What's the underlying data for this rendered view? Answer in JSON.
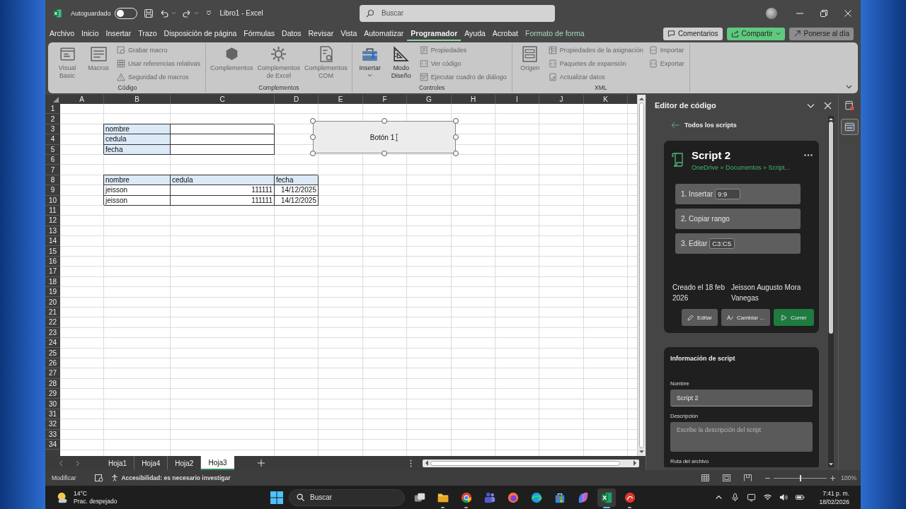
{
  "window": {
    "title": "Libro1 - Excel",
    "autosave": {
      "label": "Autoguardado",
      "on": false
    },
    "search": {
      "placeholder": "Buscar"
    }
  },
  "menu_tabs": [
    {
      "label": "Archivo",
      "kind": "standard",
      "selected": false
    },
    {
      "label": "Inicio",
      "kind": "standard",
      "selected": false
    },
    {
      "label": "Insertar",
      "kind": "standard",
      "selected": false
    },
    {
      "label": "Trazo",
      "kind": "standard",
      "selected": false
    },
    {
      "label": "Disposición de página",
      "kind": "standard",
      "selected": false
    },
    {
      "label": "Fórmulas",
      "kind": "standard",
      "selected": false
    },
    {
      "label": "Datos",
      "kind": "standard",
      "selected": false
    },
    {
      "label": "Revisar",
      "kind": "standard",
      "selected": false
    },
    {
      "label": "Vista",
      "kind": "standard",
      "selected": false
    },
    {
      "label": "Automatizar",
      "kind": "standard",
      "selected": false
    },
    {
      "label": "Programador",
      "kind": "standard",
      "selected": true
    },
    {
      "label": "Ayuda",
      "kind": "standard",
      "selected": false
    },
    {
      "label": "Acrobat",
      "kind": "standard",
      "selected": false
    },
    {
      "label": "Formato de forma",
      "kind": "contextual",
      "selected": false
    }
  ],
  "header_buttons": [
    {
      "label": "Comentarios",
      "kind": "comment"
    },
    {
      "label": "Compartir",
      "kind": "share"
    },
    {
      "label": "Ponerse al día",
      "kind": "catchup"
    }
  ],
  "ribbon": {
    "groups": [
      {
        "label": "Código",
        "columns": [
          {
            "kind": "large",
            "label": "Visual Basic",
            "disabled": true,
            "dropdown": false
          },
          {
            "kind": "large",
            "label": "Macros",
            "disabled": true,
            "dropdown": false
          },
          {
            "kind": "stack",
            "items": [
              {
                "label": "Grabar macro",
                "disabled": true
              },
              {
                "label": "Usar referencias relativas",
                "disabled": true
              },
              {
                "label": "Seguridad de macros",
                "disabled": true
              }
            ]
          }
        ]
      },
      {
        "label": "Complementos",
        "columns": [
          {
            "kind": "large",
            "label": "Complementos",
            "disabled": true,
            "dropdown": false
          },
          {
            "kind": "large",
            "label": "Complementos de Excel",
            "disabled": true,
            "dropdown": false
          },
          {
            "kind": "large",
            "label": "Complementos COM",
            "disabled": true,
            "dropdown": false
          }
        ]
      },
      {
        "label": "Controles",
        "columns": [
          {
            "kind": "large",
            "label": "Insertar",
            "disabled": false,
            "dropdown": true
          },
          {
            "kind": "large",
            "label": "Modo Diseño",
            "disabled": false,
            "dropdown": false
          },
          {
            "kind": "stack",
            "items": [
              {
                "label": "Propiedades",
                "disabled": true
              },
              {
                "label": "Ver código",
                "disabled": true
              },
              {
                "label": "Ejecutar cuadro de diálogo",
                "disabled": true
              }
            ]
          }
        ]
      },
      {
        "label": "XML",
        "columns": [
          {
            "kind": "large",
            "label": "Origen",
            "disabled": true,
            "dropdown": false
          },
          {
            "kind": "stack",
            "items": [
              {
                "label": "Propiedades de la asignación",
                "disabled": true
              },
              {
                "label": "Paquetes de expansión",
                "disabled": true
              },
              {
                "label": "Actualizar datos",
                "disabled": true
              }
            ]
          },
          {
            "kind": "stack",
            "items": [
              {
                "label": "Importar",
                "disabled": true
              },
              {
                "label": "Exportar",
                "disabled": true
              }
            ]
          }
        ]
      }
    ]
  },
  "sheet": {
    "columns": [
      "A",
      "B",
      "C",
      "D",
      "E",
      "F",
      "G",
      "H",
      "I",
      "J",
      "K"
    ],
    "rows": [
      {
        "number": "1"
      },
      {
        "number": "2"
      },
      {
        "number": "3",
        "cells": [
          {
            "kind": "empty"
          },
          {
            "kind": "header",
            "text": "nombre"
          },
          {
            "kind": "input"
          }
        ]
      },
      {
        "number": "4",
        "cells": [
          {
            "kind": "empty"
          },
          {
            "kind": "header",
            "text": "cedula"
          },
          {
            "kind": "input"
          }
        ]
      },
      {
        "number": "5",
        "cells": [
          {
            "kind": "empty"
          },
          {
            "kind": "header",
            "text": "fecha"
          },
          {
            "kind": "input"
          }
        ]
      },
      {
        "number": "6"
      },
      {
        "number": "7"
      },
      {
        "number": "8",
        "cells": [
          {
            "kind": "empty"
          },
          {
            "kind": "header",
            "text": "nombre"
          },
          {
            "kind": "header",
            "text": "cedula"
          },
          {
            "kind": "header",
            "text": "fecha"
          }
        ]
      },
      {
        "number": "9",
        "cells": [
          {
            "kind": "empty"
          },
          {
            "kind": "text",
            "text": "jeisson"
          },
          {
            "kind": "number",
            "text": "111111"
          },
          {
            "kind": "number",
            "text": "14/12/2025"
          }
        ]
      },
      {
        "number": "10",
        "cells": [
          {
            "kind": "empty"
          },
          {
            "kind": "text",
            "text": "jeisson"
          },
          {
            "kind": "number",
            "text": "111111"
          },
          {
            "kind": "number",
            "text": "14/12/2025"
          }
        ]
      },
      {
        "number": "11"
      },
      {
        "number": "12"
      },
      {
        "number": "13"
      },
      {
        "number": "14"
      },
      {
        "number": "15"
      },
      {
        "number": "16"
      },
      {
        "number": "17"
      },
      {
        "number": "18"
      },
      {
        "number": "19"
      },
      {
        "number": "20"
      },
      {
        "number": "21"
      },
      {
        "number": "22"
      },
      {
        "number": "23"
      },
      {
        "number": "24"
      },
      {
        "number": "25"
      },
      {
        "number": "26"
      },
      {
        "number": "27"
      },
      {
        "number": "28"
      },
      {
        "number": "29"
      },
      {
        "number": "30"
      },
      {
        "number": "31"
      },
      {
        "number": "32"
      },
      {
        "number": "33"
      },
      {
        "number": "34"
      }
    ],
    "shape": {
      "label": "Botón 1",
      "selected": true
    }
  },
  "sheet_tabs": [
    {
      "label": "Hoja1",
      "selected": false
    },
    {
      "label": "Hoja4",
      "selected": false
    },
    {
      "label": "Hoja2",
      "selected": false
    },
    {
      "label": "Hoja3",
      "selected": true
    }
  ],
  "code_editor": {
    "title": "Editor de código",
    "back_link": "Todos los scripts",
    "script": {
      "name": "Script 2",
      "path": "OneDrive » Documentos » Script...",
      "steps": [
        {
          "label": "1. Insertar",
          "range": "9:9"
        },
        {
          "label": "2. Copiar rango"
        },
        {
          "label": "3. Editar",
          "range": "C3:C5"
        }
      ],
      "created": "Creado el 18 feb 2026",
      "author": "Jeisson Augusto Mora Vanegas",
      "actions": [
        {
          "label": "Editar",
          "kind": "edit"
        },
        {
          "label": "Cambiar ...",
          "kind": "rename"
        },
        {
          "label": "Correr",
          "kind": "run"
        }
      ]
    },
    "info": {
      "title": "Información de script",
      "name_label": "Nombre",
      "name_value": "Script 2",
      "description_label": "Descripción",
      "description_placeholder": "Escribe la descripción del script",
      "path_label": "Ruta del archivo"
    }
  },
  "side_tools": [
    {
      "kind": "recorder",
      "selected": false
    },
    {
      "kind": "editor",
      "selected": true
    }
  ],
  "status_bar": {
    "mode": "Modificar",
    "accessibility": "Accesibilidad: es necesario investigar",
    "zoom": {
      "level": 0.5,
      "reading": "100%"
    }
  },
  "taskbar": {
    "weather": {
      "temperature": "14°C",
      "condition": "Prac. despejado"
    },
    "search": {
      "placeholder": "Buscar"
    },
    "apps": [
      {
        "kind": "taskview",
        "running": false,
        "selected": false
      },
      {
        "kind": "folder",
        "running": true,
        "selected": false
      },
      {
        "kind": "ring",
        "running": true,
        "selected": false
      },
      {
        "kind": "people",
        "running": false,
        "selected": false
      },
      {
        "kind": "fox",
        "running": false,
        "selected": false
      },
      {
        "kind": "wave",
        "running": false,
        "selected": false
      },
      {
        "kind": "bag",
        "running": false,
        "selected": false
      },
      {
        "kind": "swirl",
        "running": false,
        "selected": false
      },
      {
        "kind": "sheet",
        "running": true,
        "selected": true
      },
      {
        "kind": "flame",
        "running": true,
        "selected": false
      }
    ],
    "time": "7:41 p. m.",
    "date": "18/02/2026"
  }
}
